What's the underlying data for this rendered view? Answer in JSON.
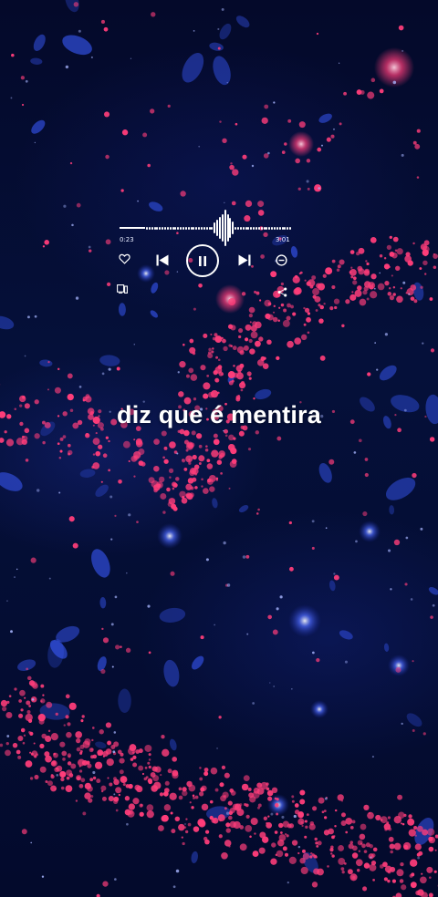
{
  "player": {
    "elapsed_time": "0:23",
    "total_time": "3:01",
    "progress": 0.13,
    "playback_state": "playing",
    "icons": {
      "like": "heart-icon",
      "previous": "skip-previous-icon",
      "pause": "pause-icon",
      "next": "skip-next-icon",
      "remove": "minus-circle-icon",
      "device": "device-icon",
      "share": "share-icon"
    }
  },
  "lyric": {
    "text": "diz que é mentira"
  },
  "colors": {
    "background": "#04092a",
    "particle_pink": "#ff3d7a",
    "particle_blue": "#3a5bff",
    "text": "#ffffff"
  }
}
